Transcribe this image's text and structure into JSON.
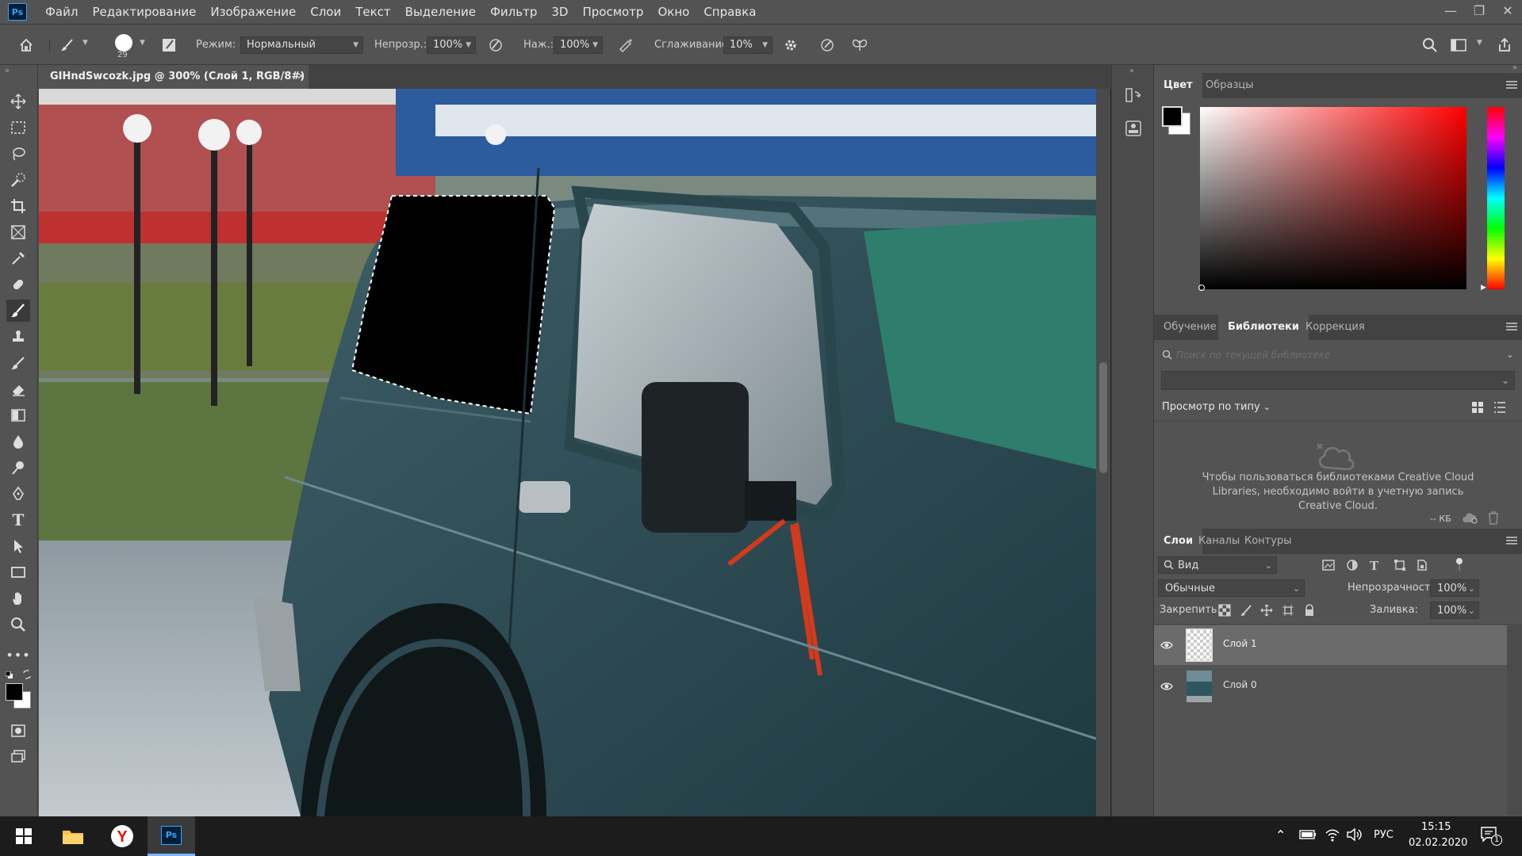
{
  "app": {
    "logo": "Ps",
    "menu": [
      "Файл",
      "Редактирование",
      "Изображение",
      "Слои",
      "Текст",
      "Выделение",
      "Фильтр",
      "3D",
      "Просмотр",
      "Окно",
      "Справка"
    ]
  },
  "options": {
    "brush_size": "29",
    "mode_label": "Режим:",
    "mode_value": "Нормальный",
    "opacity_label": "Непрозр.:",
    "opacity_value": "100%",
    "pressure_label": "Наж.:",
    "pressure_value": "100%",
    "smoothing_label": "Сглаживание:",
    "smoothing_value": "10%"
  },
  "document": {
    "tab_title": "GIHndSwcozk.jpg @ 300% (Слой 1, RGB/8#) *",
    "close_glyph": "×"
  },
  "color_panel": {
    "tabs": [
      "Цвет",
      "Образцы"
    ],
    "active_tab": 0,
    "foreground": "#000000",
    "background": "#ffffff"
  },
  "libraries_panel": {
    "tabs": [
      "Обучение",
      "Библиотеки",
      "Коррекция"
    ],
    "active_tab": 1,
    "search_placeholder": "Поиск по текущей библиотеке",
    "view_by_type": "Просмотр по типу",
    "message": "Чтобы пользоваться библиотеками Creative Cloud Libraries, необходимо войти в учетную запись Creative Cloud.",
    "size_label": "-- КБ"
  },
  "layers_panel": {
    "tabs": [
      "Слои",
      "Каналы",
      "Контуры"
    ],
    "active_tab": 0,
    "filter_label": "Вид",
    "blend_mode": "Обычные",
    "opacity_label": "Непрозрачность:",
    "opacity_value": "100%",
    "lock_label": "Закрепить:",
    "fill_label": "Заливка:",
    "fill_value": "100%",
    "layers": [
      {
        "name": "Слой 1",
        "visible": true,
        "selected": true
      },
      {
        "name": "Слой 0",
        "visible": true,
        "selected": false
      }
    ]
  },
  "taskbar": {
    "language": "РУС",
    "time": "15:15",
    "date": "02.02.2020",
    "notifications": "1"
  }
}
